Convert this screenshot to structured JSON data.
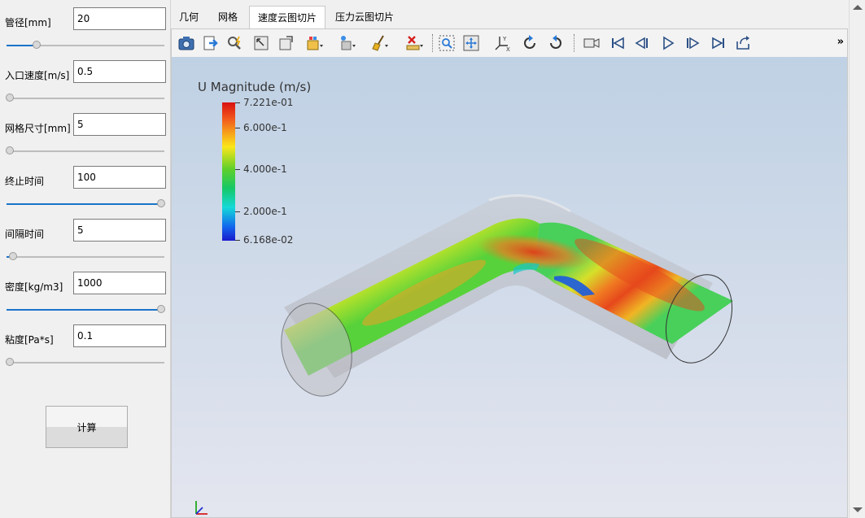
{
  "params": [
    {
      "label": "管径[mm]",
      "value": "20",
      "slider": 0.19
    },
    {
      "label": "入口速度[m/s]",
      "value": "0.5",
      "slider": 0.0
    },
    {
      "label": "网格尺寸[mm]",
      "value": "5",
      "slider": 0.02
    },
    {
      "label": "终止时间",
      "value": "100",
      "slider": 1.0
    },
    {
      "label": "间隔时间",
      "value": "5",
      "slider": 0.04
    },
    {
      "label": "密度[kg/m3]",
      "value": "1000",
      "slider": 1.0
    },
    {
      "label": "粘度[Pa*s]",
      "value": "0.1",
      "slider": 0.0
    }
  ],
  "calc_button": "计算",
  "tabs": [
    {
      "label": "几何",
      "active": false
    },
    {
      "label": "网格",
      "active": false
    },
    {
      "label": "速度云图切片",
      "active": true
    },
    {
      "label": "压力云图切片",
      "active": false
    }
  ],
  "toolbar": {
    "icons": [
      "camera-icon",
      "export-icon",
      "query-icon",
      "select-icon",
      "reset-view-icon",
      "color-map-icon",
      "lighting-icon",
      "clear-brush-icon",
      "delete-ruler-icon",
      "zoom-box-icon",
      "fit-view-icon",
      "axes-orient-icon",
      "rotate-ccw-icon",
      "rotate-cw-icon",
      "video-camera-icon",
      "first-frame-icon",
      "prev-frame-icon",
      "play-icon",
      "next-frame-icon",
      "last-frame-icon",
      "loop-icon"
    ],
    "more": "»"
  },
  "legend": {
    "title": "U Magnitude (m/s)",
    "max_label": "7.221e-01",
    "min_label": "6.168e-02",
    "ticks": [
      {
        "label": "6.000e-1",
        "value": 0.6
      },
      {
        "label": "4.000e-1",
        "value": 0.4
      },
      {
        "label": "2.000e-1",
        "value": 0.2
      }
    ],
    "min": 0.06168,
    "max": 0.7221
  },
  "colors": {
    "accent": "#1a73c9",
    "red": "#d91010",
    "yellow": "#fbe61a",
    "green": "#60d02a",
    "blue": "#1366ee"
  }
}
